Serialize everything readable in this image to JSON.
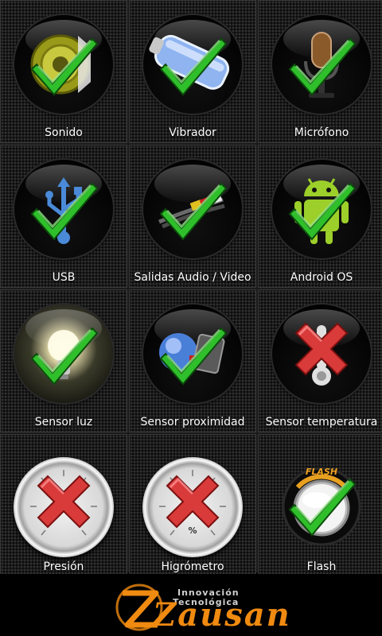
{
  "tiles": [
    {
      "label": "Sonido",
      "status": "ok",
      "icon": "speaker-icon"
    },
    {
      "label": "Vibrador",
      "status": "ok",
      "icon": "vibrator-icon"
    },
    {
      "label": "Micrófono",
      "status": "ok",
      "icon": "microphone-icon"
    },
    {
      "label": "USB",
      "status": "ok",
      "icon": "usb-icon"
    },
    {
      "label": "Salidas Audio / Video",
      "status": "ok",
      "icon": "av-cable-icon"
    },
    {
      "label": "Android OS",
      "status": "ok",
      "icon": "android-icon"
    },
    {
      "label": "Sensor luz",
      "status": "ok",
      "icon": "light-bulb-icon"
    },
    {
      "label": "Sensor proximidad",
      "status": "ok",
      "icon": "proximity-icon"
    },
    {
      "label": "Sensor temperatura",
      "status": "fail",
      "icon": "thermometer-icon"
    },
    {
      "label": "Presión",
      "status": "fail",
      "icon": "barometer-icon"
    },
    {
      "label": "Higrómetro",
      "status": "fail",
      "icon": "hygrometer-icon"
    },
    {
      "label": "Flash",
      "status": "ok",
      "icon": "flash-icon"
    }
  ],
  "gauge_text": {
    "hygrometer_symbol": "%",
    "flash_ring": "FLASH"
  },
  "logo": {
    "line1": "Innovación",
    "line2": "Tecnológica",
    "word": "Zausan"
  },
  "colors": {
    "ok": "#3ec93a",
    "fail": "#d93a3a",
    "accent": "#f08a10"
  }
}
